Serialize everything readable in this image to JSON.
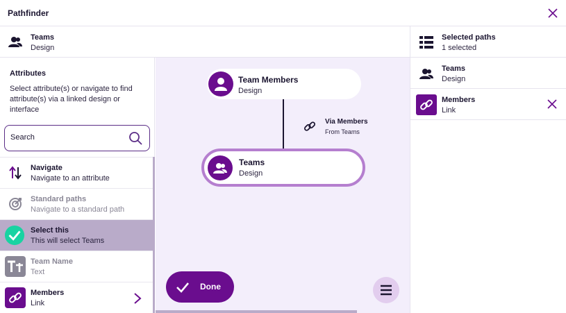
{
  "title": "Pathfinder",
  "context": {
    "name": "Teams",
    "type": "Design"
  },
  "left_panel": {
    "heading": "Attributes",
    "description": "Select attribute(s) or navigate to find attribute(s) via a linked design or interface",
    "search_placeholder": "Search",
    "items": [
      {
        "label": "Navigate",
        "sub": "Navigate to an attribute",
        "icon": "up-down-arrows-icon",
        "state": "normal"
      },
      {
        "label": "Standard paths",
        "sub": "Navigate to a standard path",
        "icon": "target-icon",
        "state": "disabled"
      },
      {
        "label": "Select this",
        "sub": "This will select Teams",
        "icon": "check-circle-icon",
        "state": "selected"
      },
      {
        "label": "Team Name",
        "sub": "Text",
        "icon": "text-type-icon",
        "state": "disabled"
      },
      {
        "label": "Members",
        "sub": "Link",
        "icon": "link-icon",
        "state": "normal"
      }
    ]
  },
  "canvas": {
    "node_top": {
      "name": "Team Members",
      "type": "Design"
    },
    "via": {
      "label": "Via Members",
      "sub": "From Teams"
    },
    "node_bottom": {
      "name": "Teams",
      "type": "Design"
    },
    "done_label": "Done"
  },
  "right_panel": {
    "header": {
      "title": "Selected paths",
      "count": "1 selected"
    },
    "rows": [
      {
        "label": "Teams",
        "sub": "Design",
        "icon": "people-icon"
      },
      {
        "label": "Members",
        "sub": "Link",
        "icon": "link-icon"
      }
    ]
  },
  "colors": {
    "accent": "#6a0d8e",
    "selected_bg": "#b9abc9",
    "canvas_bg": "#f3eefb",
    "success": "#19d3a2",
    "node_ring": "#b57fcf"
  }
}
